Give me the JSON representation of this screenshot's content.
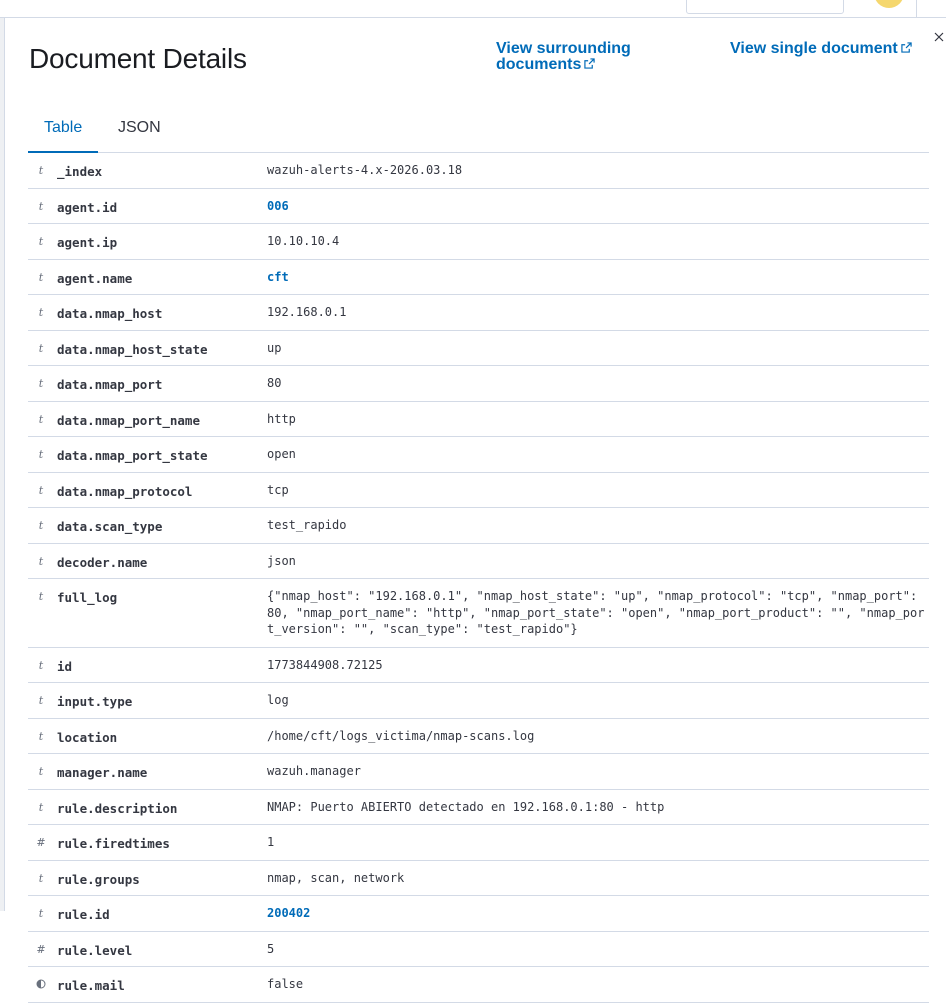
{
  "flyout": {
    "title": "Document Details",
    "view_surrounding_line1": "View surrounding",
    "view_surrounding_line2": "documents",
    "view_single": "View single document",
    "close_icon": "close-icon",
    "external_icon": "popout-icon"
  },
  "tabs": [
    {
      "label": "Table",
      "active": true
    },
    {
      "label": "JSON",
      "active": false
    }
  ],
  "fields": [
    {
      "type": "t",
      "name": "_index",
      "value": "wazuh-alerts-4.x-2026.03.18",
      "link": false
    },
    {
      "type": "t",
      "name": "agent.id",
      "value": "006",
      "link": true
    },
    {
      "type": "t",
      "name": "agent.ip",
      "value": "10.10.10.4",
      "link": false
    },
    {
      "type": "t",
      "name": "agent.name",
      "value": "cft",
      "link": true
    },
    {
      "type": "t",
      "name": "data.nmap_host",
      "value": "192.168.0.1",
      "link": false
    },
    {
      "type": "t",
      "name": "data.nmap_host_state",
      "value": "up",
      "link": false
    },
    {
      "type": "t",
      "name": "data.nmap_port",
      "value": "80",
      "link": false
    },
    {
      "type": "t",
      "name": "data.nmap_port_name",
      "value": "http",
      "link": false
    },
    {
      "type": "t",
      "name": "data.nmap_port_state",
      "value": "open",
      "link": false
    },
    {
      "type": "t",
      "name": "data.nmap_protocol",
      "value": "tcp",
      "link": false
    },
    {
      "type": "t",
      "name": "data.scan_type",
      "value": "test_rapido",
      "link": false
    },
    {
      "type": "t",
      "name": "decoder.name",
      "value": "json",
      "link": false
    },
    {
      "type": "t",
      "name": "full_log",
      "value": "{\"nmap_host\": \"192.168.0.1\", \"nmap_host_state\": \"up\", \"nmap_protocol\": \"tcp\", \"nmap_port\": 80, \"nmap_port_name\": \"http\", \"nmap_port_state\": \"open\", \"nmap_port_product\": \"\", \"nmap_port_version\": \"\", \"scan_type\": \"test_rapido\"}",
      "link": false
    },
    {
      "type": "t",
      "name": "id",
      "value": "1773844908.72125",
      "link": false
    },
    {
      "type": "t",
      "name": "input.type",
      "value": "log",
      "link": false
    },
    {
      "type": "t",
      "name": "location",
      "value": "/home/cft/logs_victima/nmap-scans.log",
      "link": false
    },
    {
      "type": "t",
      "name": "manager.name",
      "value": "wazuh.manager",
      "link": false
    },
    {
      "type": "t",
      "name": "rule.description",
      "value": "NMAP: Puerto ABIERTO detectado en 192.168.0.1:80 - http",
      "link": false
    },
    {
      "type": "#",
      "name": "rule.firedtimes",
      "value": "1",
      "link": false
    },
    {
      "type": "t",
      "name": "rule.groups",
      "value": "nmap, scan, network",
      "link": false
    },
    {
      "type": "t",
      "name": "rule.id",
      "value": "200402",
      "link": true
    },
    {
      "type": "#",
      "name": "rule.level",
      "value": "5",
      "link": false
    },
    {
      "type": "bool",
      "name": "rule.mail",
      "value": "false",
      "link": false
    }
  ],
  "colors": {
    "accent": "#006bb8",
    "border": "#d3dae6",
    "text": "#343741"
  }
}
